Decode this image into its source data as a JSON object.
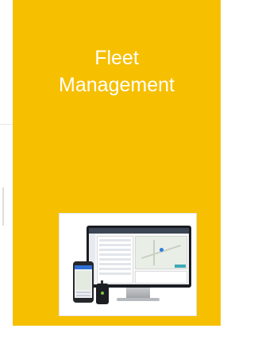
{
  "card": {
    "title_line1": "Fleet",
    "title_line2": "Management",
    "background": "#f6bf00",
    "text_color": "#ffffff"
  },
  "product_image": {
    "icon": "fleet-dashboard-devices-image"
  }
}
